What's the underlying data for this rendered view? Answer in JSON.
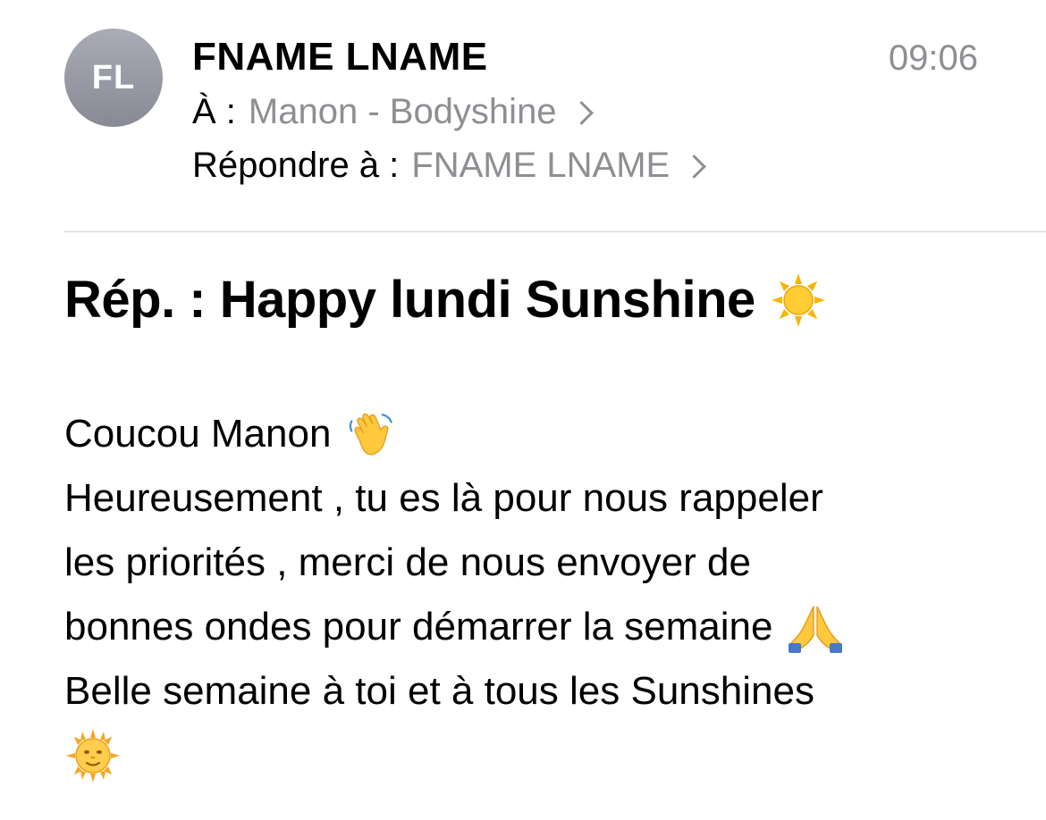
{
  "email": {
    "avatar_initials": "FL",
    "sender_name": "FNAME LNAME",
    "time": "09:06",
    "to_label": "À :",
    "to_value": "Manon - Bodyshine",
    "reply_label": "Répondre à :",
    "reply_value": "FNAME LNAME",
    "subject": "Rép. : Happy lundi Sunshine",
    "subject_icon": "sun-icon",
    "body_lines": [
      {
        "text": "Coucou Manon",
        "icon": "waving-hand-icon"
      },
      {
        "text": "Heureusement , tu es là pour nous rappeler"
      },
      {
        "text": "les priorités , merci de nous envoyer de"
      },
      {
        "text": "bonnes ondes pour démarrer la semaine",
        "icon": "folded-hands-icon"
      },
      {
        "text": "Belle semaine à toi et à tous les Sunshines"
      },
      {
        "text": "",
        "icon": "sun-with-face-icon"
      }
    ]
  },
  "colors": {
    "accent_gray": "#8e8e93",
    "avatar_gray": "#9a9da6",
    "divider": "#d1d1d6"
  }
}
